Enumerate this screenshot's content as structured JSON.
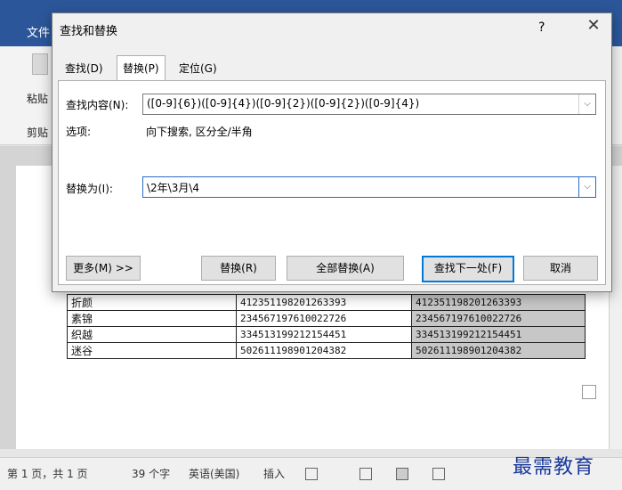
{
  "word": {
    "file_tab": "文件",
    "paste_label": "粘贴",
    "clipboard_label": "剪贴",
    "table_rows": [
      [
        "折颜",
        "412351198201263393",
        "412351198201263393"
      ],
      [
        "素锦",
        "234567197610022726",
        "234567197610022726"
      ],
      [
        "织越",
        "334513199212154451",
        "334513199212154451"
      ],
      [
        "迷谷",
        "502611198901204382",
        "502611198901204382"
      ]
    ],
    "status": {
      "page": "第 1 页，共 1 页",
      "words": "39 个字",
      "language": "英语(美国)",
      "mode": "插入"
    },
    "watermark": "最需教育"
  },
  "dialog": {
    "title": "查找和替换",
    "help": "?",
    "close": "✕",
    "tabs": [
      "查找(D)",
      "替换(P)",
      "定位(G)"
    ],
    "find_label": "查找内容(N):",
    "find_value": "([0-9]{6})([0-9]{4})([0-9]{2})([0-9]{2})([0-9]{4})",
    "options_label": "选项:",
    "options_value": "向下搜索, 区分全/半角",
    "replace_label": "替换为(I):",
    "replace_value": "\\2年\\3月\\4",
    "more_button": "更多(M) >>",
    "replace_button": "替换(R)",
    "replace_all_button": "全部替换(A)",
    "find_next_button": "查找下一处(F)",
    "cancel_button": "取消"
  }
}
